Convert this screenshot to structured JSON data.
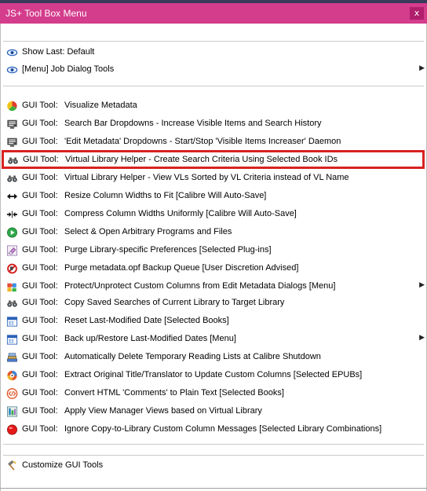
{
  "window": {
    "title": "JS+ Tool Box Menu",
    "close_label": "x"
  },
  "menu": {
    "show_last": {
      "label": "Show Last: Default",
      "icon": "eye-icon"
    },
    "job_dialog": {
      "label": "[Menu] Job Dialog Tools",
      "icon": "eye-icon",
      "arrow": "▶"
    },
    "gui_prefix": "GUI Tool:",
    "gui_tools": [
      {
        "label": "Visualize Metadata",
        "icon": "pie-chart-icon"
      },
      {
        "label": "Search Bar Dropdowns - Increase Visible Items and Search History",
        "icon": "monitor-icon"
      },
      {
        "label": "'Edit Metadata' Dropdowns - Start/Stop 'Visible Items Increaser' Daemon",
        "icon": "monitor-icon"
      },
      {
        "label": "Virtual Library Helper - Create Search Criteria Using Selected Book IDs",
        "icon": "binoculars-icon"
      },
      {
        "label": "Virtual Library Helper - View VLs Sorted by VL Criteria instead of VL Name",
        "icon": "binoculars-icon"
      },
      {
        "label": "Resize Column Widths to Fit [Calibre Will Auto-Save]",
        "icon": "expand-arrows-icon"
      },
      {
        "label": "Compress Column Widths Uniformly [Calibre Will Auto-Save]",
        "icon": "compress-arrows-icon"
      },
      {
        "label": "Select & Open Arbitrary Programs and Files",
        "icon": "play-icon"
      },
      {
        "label": "Purge Library-specific Preferences [Selected Plug-ins]",
        "icon": "eraser-icon"
      },
      {
        "label": "Purge metadata.opf Backup Queue [User Discretion Advised]",
        "icon": "no-entry-icon"
      },
      {
        "label": "Protect/Unprotect Custom Columns from Edit Metadata Dialogs [Menu]",
        "icon": "puzzle-icon",
        "arrow": "▶"
      },
      {
        "label": "Copy Saved Searches of Current Library to Target Library",
        "icon": "binoculars-icon"
      },
      {
        "label": "Reset Last-Modified Date [Selected Books]",
        "icon": "calendar-icon"
      },
      {
        "label": "Back up/Restore Last-Modified Dates [Menu]",
        "icon": "calendar-icon",
        "arrow": "▶"
      },
      {
        "label": "Automatically Delete Temporary Reading Lists at Calibre Shutdown",
        "icon": "books-icon"
      },
      {
        "label": "Extract Original Title/Translator to Update Custom Columns [Selected EPUBs]",
        "icon": "gear-icon"
      },
      {
        "label": "Convert HTML 'Comments' to Plain Text [Selected Books]",
        "icon": "html-icon"
      },
      {
        "label": "Apply View Manager Views based on Virtual Library",
        "icon": "view-manager-icon"
      },
      {
        "label": "Ignore Copy-to-Library Custom Column Messages [Selected Library Combinations]",
        "icon": "red-circle-icon"
      }
    ],
    "customize": {
      "label": "Customize GUI Tools",
      "icon": "hammer-icon"
    }
  },
  "colors": {
    "title_bar": "#d43c8c",
    "close_button": "#b01e6c",
    "highlight_border": "#d92121"
  }
}
